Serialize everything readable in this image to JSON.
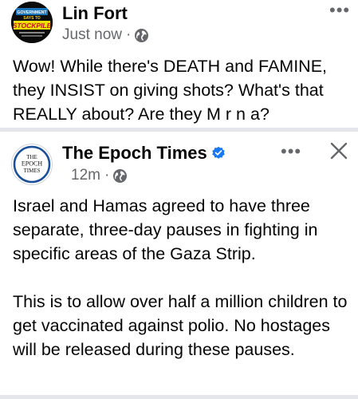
{
  "post1": {
    "author": "Lin Fort",
    "timestamp": "Just now",
    "separator": "·",
    "privacy_icon": "globe-icon",
    "avatar_text_top": "GOVERNMENT",
    "avatar_text_mid": "SAYS TO",
    "avatar_text_main": "STOCKPILE",
    "text": "Wow! While there's DEATH and FAMINE, they INSIST on giving shots? What's that REALLY about? Are they M r n a?"
  },
  "post2": {
    "author": "The Epoch Times",
    "verified_icon": "verified-badge-icon",
    "timestamp": "12m",
    "separator": "·",
    "privacy_icon": "globe-icon",
    "avatar_line1": "THE",
    "avatar_line2": "EPOCH",
    "avatar_line3": "TIMES",
    "text": "Israel and Hamas agreed to have three separate, three-day pauses in fighting in specific areas of the Gaza Strip.\n\nThis is to allow over half a million children to get vaccinated against polio. No hostages will be released during these pauses."
  },
  "colors": {
    "verified_blue": "#1877f2",
    "meta_gray": "#65676b",
    "separator_gray": "#e4e6eb"
  }
}
